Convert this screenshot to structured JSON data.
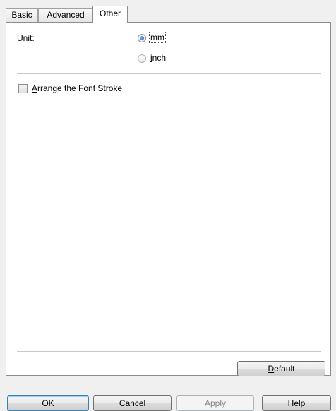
{
  "tabs": [
    {
      "label": "Basic"
    },
    {
      "label": "Advanced"
    },
    {
      "label": "Other",
      "active": true
    }
  ],
  "unit": {
    "label": "Unit:",
    "options": [
      {
        "label": "mm",
        "selected": true
      },
      {
        "label": "inch",
        "selected": false,
        "mnemonic": "i"
      }
    ]
  },
  "arrange_font_stroke": {
    "label": "Arrange the Font Stroke",
    "checked": false,
    "mnemonic": "A"
  },
  "default_button": {
    "label": "Default",
    "mnemonic": "D"
  },
  "buttons": {
    "ok": "OK",
    "cancel": "Cancel",
    "apply": "Apply",
    "apply_mnemonic": "A",
    "help": "Help",
    "help_mnemonic": "H"
  }
}
